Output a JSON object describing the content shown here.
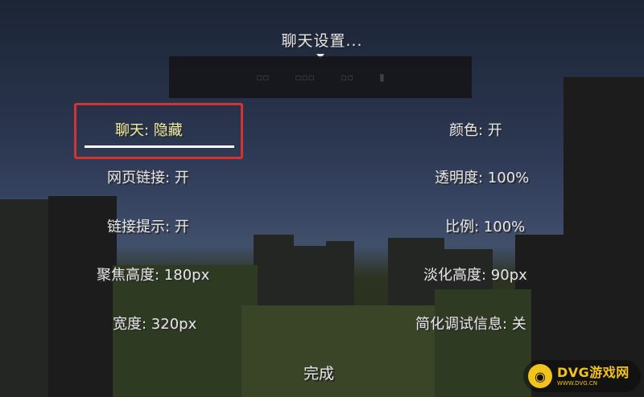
{
  "screen_title": "聊天设置...",
  "left_options": [
    {
      "text": "聊天: 隐藏",
      "selected": true
    },
    {
      "text": "网页链接: 开"
    },
    {
      "text": "链接提示: 开"
    },
    {
      "text": "聚焦高度: 180px"
    },
    {
      "text": "宽度: 320px"
    }
  ],
  "right_options": [
    {
      "text": "颜色: 开"
    },
    {
      "text": "透明度: 100%"
    },
    {
      "text": "比例: 100%"
    },
    {
      "text": "淡化高度: 90px"
    },
    {
      "text": "简化调试信息: 关"
    }
  ],
  "done_label": "完成",
  "watermark": {
    "logo": "◉",
    "main": "DVG游戏网",
    "sub": "WWW.DVG.CN"
  },
  "colors": {
    "highlight": "#d23333",
    "selected_text": "#f0eea0",
    "text": "#e6e6e6",
    "watermark": "#f2c31b"
  }
}
